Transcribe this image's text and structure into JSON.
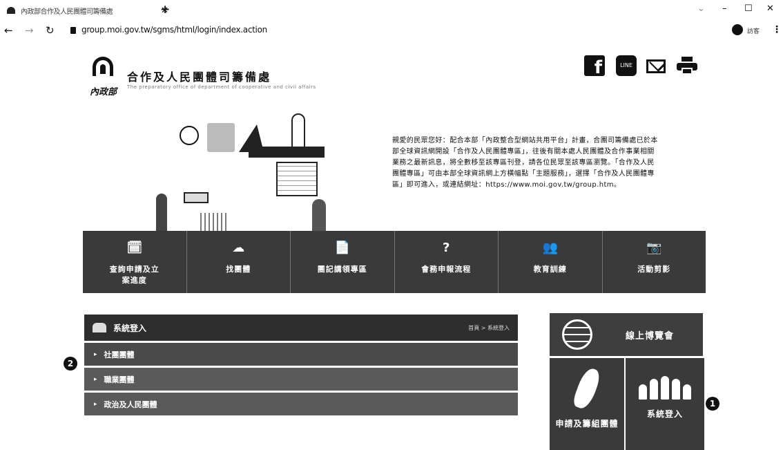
{
  "browser": {
    "tab_title": "內政部合作及人民團體司籌備處",
    "url": "group.moi.gov.tw/sgms/html/login/index.action",
    "profile_label": "訪客"
  },
  "header": {
    "ministry": "內政部",
    "title": "合作及人民團體司籌備處",
    "subtitle": "The preparatory office of department of cooperative and civil affairs"
  },
  "notice": "親愛的民眾您好：配合本部「內政整合型網站共用平台」計畫，合團司籌備處已於本部全球資訊網開設「合作及人民團體專區」，往後有關本處人民團體及合作事業相關業務之最新訊息，將全數移至該專區刊登，請各位民眾至該專區瀏覽。「合作及人民團體專區」可由本部全球資訊網上方橫幅點「主題服務」，選擇「合作及人民團體專區」即可進入，或連結網址：https://www.moi.gov.tw/group.htm。",
  "nav_tiles": [
    {
      "icon": "🗓",
      "label": "查詢申請及立案進度"
    },
    {
      "icon": "☁",
      "label": "找團體"
    },
    {
      "icon": "📄",
      "label": "團記講領專區"
    },
    {
      "icon": "?",
      "label": "會務申報流程"
    },
    {
      "icon": "👥",
      "label": "教育訓練"
    },
    {
      "icon": "📷",
      "label": "活動剪影"
    }
  ],
  "login_panel": {
    "title": "系統登入",
    "breadcrumb": "首頁 > 系統登入",
    "items": [
      "社團團體",
      "職業團體",
      "政治及人民團體"
    ]
  },
  "side": {
    "expo_label": "線上博覽會",
    "apply_label": "申請及籌組團體",
    "system_label": "系統登入"
  },
  "badges": {
    "one": "1",
    "two": "2"
  }
}
